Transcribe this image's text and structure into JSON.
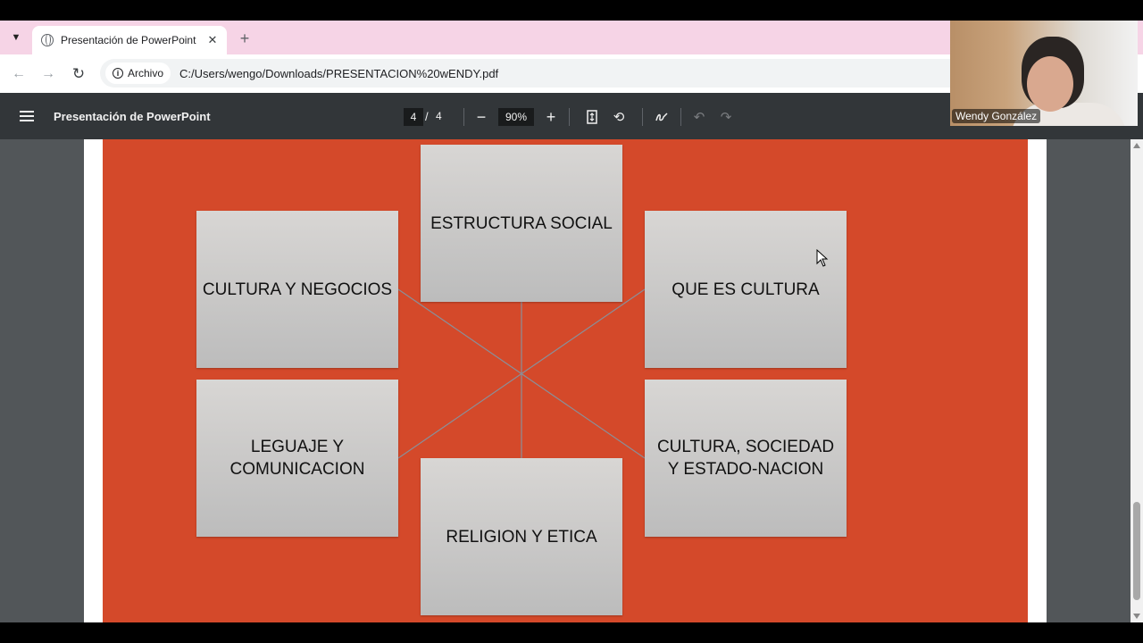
{
  "browser": {
    "tab_title": "Presentación de PowerPoint",
    "new_tab_symbol": "+",
    "close_symbol": "✕",
    "site_chip": "Archivo",
    "url": "C:/Users/wengo/Downloads/PRESENTACION%20wENDY.pdf"
  },
  "pdf_viewer": {
    "title": "Presentación de PowerPoint",
    "current_page": "4",
    "page_separator": "/",
    "total_pages": "4",
    "zoom": "90%",
    "zoom_out_symbol": "−",
    "zoom_in_symbol": "+"
  },
  "slide": {
    "background_color": "#d4492a",
    "boxes": [
      {
        "label": "ESTRUCTURA SOCIAL"
      },
      {
        "label": "CULTURA Y NEGOCIOS"
      },
      {
        "label": "QUE ES CULTURA"
      },
      {
        "label": "LEGUAJE Y COMUNICACION"
      },
      {
        "label": "CULTURA, SOCIEDAD Y ESTADO-NACION"
      },
      {
        "label": "RELIGION Y ETICA"
      }
    ]
  },
  "video_call": {
    "participant_name": "Wendy González"
  },
  "icons": [
    "tab-list-icon",
    "globe-icon",
    "close-icon",
    "back-icon",
    "forward-icon",
    "reload-icon",
    "info-icon",
    "menu-icon",
    "fit-page-icon",
    "rotate-icon",
    "annotate-icon",
    "undo-icon",
    "redo-icon",
    "cursor-icon"
  ]
}
